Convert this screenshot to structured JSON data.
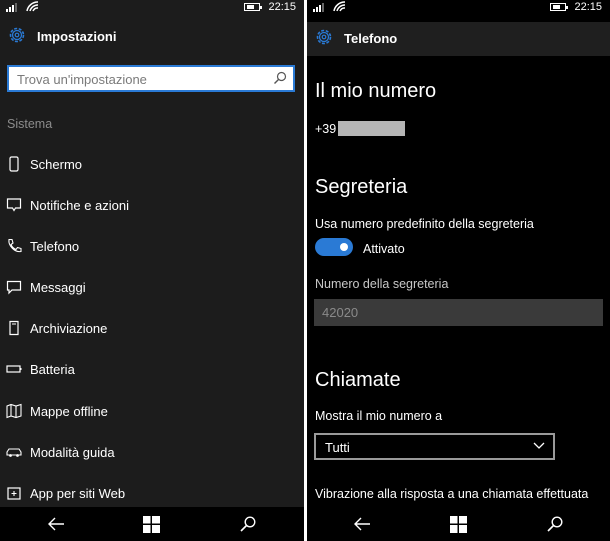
{
  "status": {
    "time": "22:15"
  },
  "left": {
    "title": "Impostazioni",
    "search_placeholder": "Trova un'impostazione",
    "section": "Sistema",
    "items": [
      {
        "label": "Schermo",
        "icon": "phone-screen-icon"
      },
      {
        "label": "Notifiche e azioni",
        "icon": "notification-icon"
      },
      {
        "label": "Telefono",
        "icon": "phone-icon"
      },
      {
        "label": "Messaggi",
        "icon": "message-icon"
      },
      {
        "label": "Archiviazione",
        "icon": "storage-icon"
      },
      {
        "label": "Batteria",
        "icon": "battery-icon"
      },
      {
        "label": "Mappe offline",
        "icon": "map-icon"
      },
      {
        "label": "Modalità guida",
        "icon": "car-icon"
      },
      {
        "label": "App per siti Web",
        "icon": "web-app-icon"
      }
    ]
  },
  "right": {
    "title": "Telefono",
    "my_number_heading": "Il mio numero",
    "my_number_prefix": "+39",
    "voicemail_heading": "Segreteria",
    "use_default_label": "Usa numero predefinito della segreteria",
    "toggle_state": "Attivato",
    "voicemail_number_label": "Numero della segreteria",
    "voicemail_number_value": "42020",
    "calls_heading": "Chiamate",
    "show_number_label": "Mostra il mio numero a",
    "show_number_value": "Tutti",
    "vibration_label": "Vibrazione alla risposta a una chiamata effettuata"
  },
  "colors": {
    "accent": "#2a7ad5",
    "left_bg": "#1c1c1c",
    "right_bg": "#000000"
  }
}
